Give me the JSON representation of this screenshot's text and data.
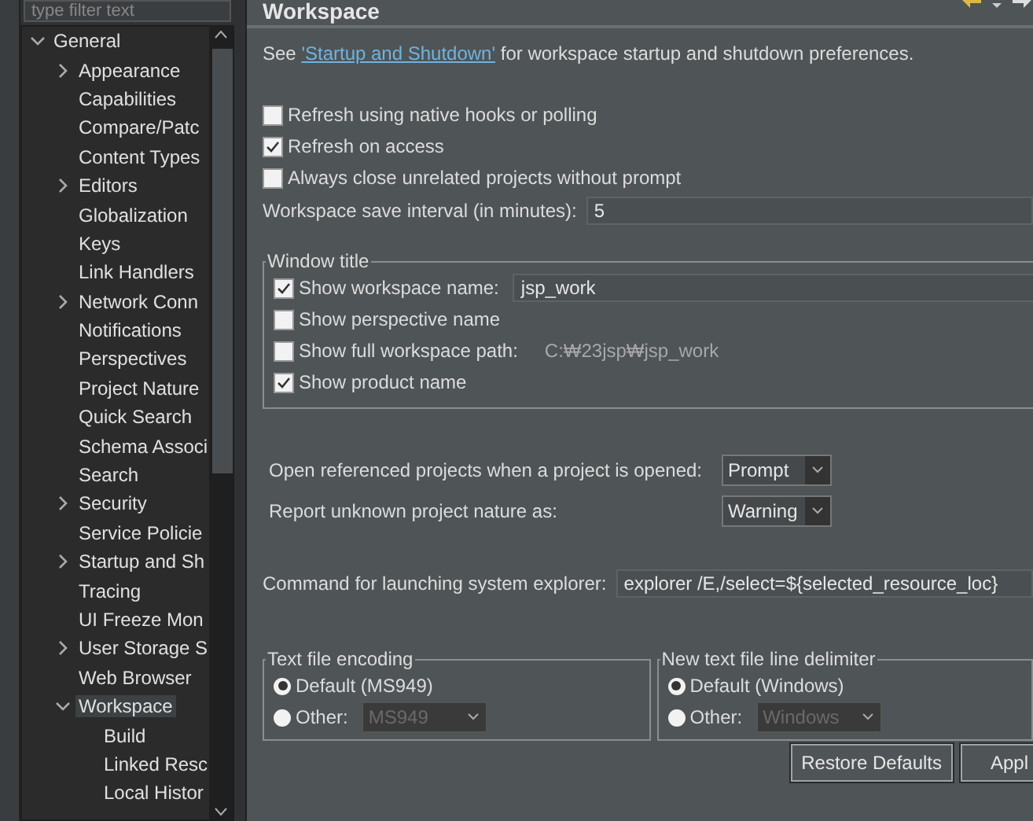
{
  "filter": {
    "placeholder": "type filter text"
  },
  "tree": [
    {
      "label": "General",
      "expanded": true,
      "selected": false,
      "children": [
        {
          "label": "Appearance",
          "expanded": false,
          "selected": false
        },
        {
          "label": "Capabilities",
          "selected": false
        },
        {
          "label": "Compare/Patc",
          "selected": false
        },
        {
          "label": "Content Types",
          "selected": false
        },
        {
          "label": "Editors",
          "expanded": false,
          "selected": false
        },
        {
          "label": "Globalization",
          "selected": false
        },
        {
          "label": "Keys",
          "selected": false
        },
        {
          "label": "Link Handlers",
          "selected": false
        },
        {
          "label": "Network Conn",
          "expanded": false,
          "selected": false
        },
        {
          "label": "Notifications",
          "selected": false
        },
        {
          "label": "Perspectives",
          "selected": false
        },
        {
          "label": "Project Nature",
          "selected": false
        },
        {
          "label": "Quick Search",
          "selected": false
        },
        {
          "label": "Schema Associ",
          "selected": false
        },
        {
          "label": "Search",
          "selected": false
        },
        {
          "label": "Security",
          "expanded": false,
          "selected": false
        },
        {
          "label": "Service Policie",
          "selected": false
        },
        {
          "label": "Startup and Sh",
          "expanded": false,
          "selected": false
        },
        {
          "label": "Tracing",
          "selected": false
        },
        {
          "label": "UI Freeze Mon",
          "selected": false
        },
        {
          "label": "User Storage S",
          "expanded": false,
          "selected": false
        },
        {
          "label": "Web Browser",
          "selected": false
        },
        {
          "label": "Workspace",
          "expanded": true,
          "selected": true,
          "children": [
            {
              "label": "Build",
              "selected": false
            },
            {
              "label": "Linked Resc",
              "selected": false
            },
            {
              "label": "Local Histor",
              "selected": false
            }
          ]
        }
      ]
    }
  ],
  "page": {
    "title": "Workspace",
    "intro_before": "See ",
    "intro_link": "'Startup and Shutdown'",
    "intro_after": " for workspace startup and shutdown preferences.",
    "checkboxes": [
      {
        "label": "Refresh using native hooks or polling",
        "checked": false
      },
      {
        "label": "Refresh on access",
        "checked": true
      },
      {
        "label": "Always close unrelated projects without prompt",
        "checked": false
      }
    ],
    "save_interval": {
      "label": "Workspace save interval (in minutes):",
      "value": "5"
    },
    "window_title": {
      "title": "Window title",
      "options": [
        {
          "kind": "field",
          "label": "Show workspace name:",
          "checked": true,
          "value": "jsp_work"
        },
        {
          "kind": "plain",
          "label": "Show perspective name",
          "checked": false
        },
        {
          "kind": "path",
          "label": "Show full workspace path:",
          "checked": false,
          "value": "C:₩23jsp₩jsp_work"
        },
        {
          "kind": "plain",
          "label": "Show product name",
          "checked": true
        }
      ]
    },
    "combos": [
      {
        "label": "Open referenced projects when a project is opened:",
        "value": "Prompt"
      },
      {
        "label": "Report unknown project nature as:",
        "value": "Warning"
      }
    ],
    "explorer": {
      "label": "Command for launching system explorer:",
      "value": "explorer /E,/select=${selected_resource_loc}"
    },
    "groups": [
      {
        "title": "Text file encoding",
        "options": [
          {
            "label": "Default (MS949)",
            "selected": true
          },
          {
            "label": "Other:",
            "selected": false
          }
        ],
        "other_value": "MS949",
        "disabled": true
      },
      {
        "title": "New text file line delimiter",
        "options": [
          {
            "label": "Default (Windows)",
            "selected": true
          },
          {
            "label": "Other:",
            "selected": false
          }
        ],
        "other_value": "Windows",
        "disabled": true
      }
    ],
    "buttons": [
      "Restore Defaults",
      "Appl"
    ]
  }
}
